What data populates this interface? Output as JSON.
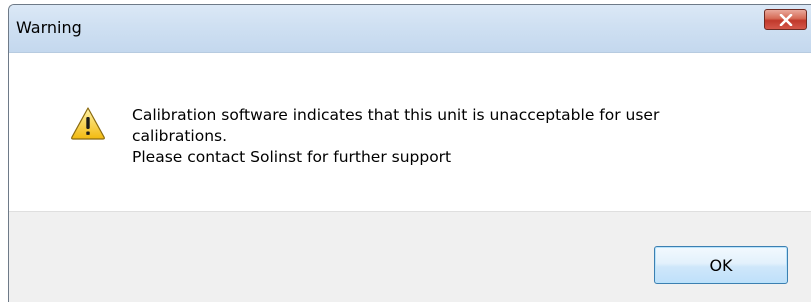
{
  "dialog": {
    "title": "Warning",
    "message_lines": [
      "Calibration software indicates that this unit is unacceptable for user",
      "calibrations.",
      "Please contact Solinst for further support"
    ],
    "ok_label": "OK",
    "icon": "warning-icon",
    "close_icon": "close-icon"
  },
  "colors": {
    "titlebar": "#cfe0f2",
    "close_button": "#c0392b",
    "footer": "#f0f0f0",
    "ok_border": "#3c7fb1",
    "warning_yellow": "#f5c518"
  }
}
